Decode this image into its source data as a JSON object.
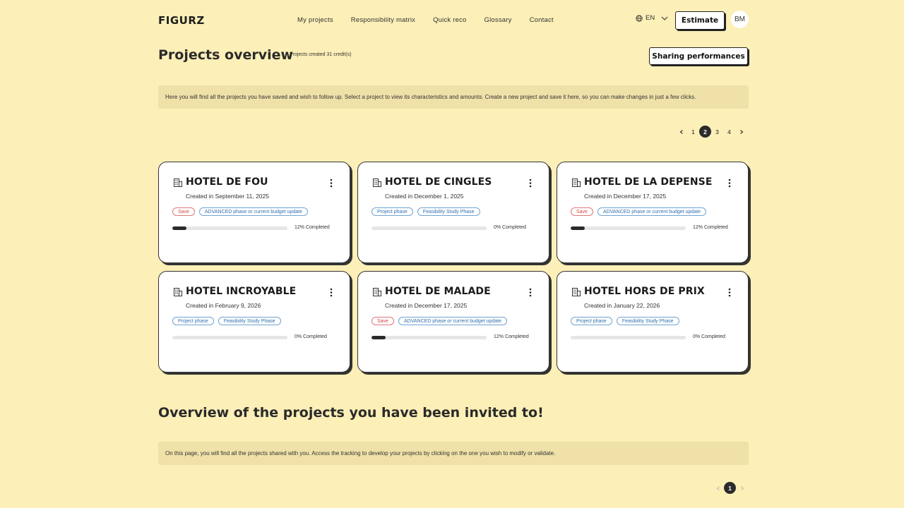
{
  "brand": {
    "logo": "FIGURZ"
  },
  "nav": {
    "items": [
      {
        "label": "My projects"
      },
      {
        "label": "Responsibility matrix"
      },
      {
        "label": "Quick reco"
      },
      {
        "label": "Glossary"
      },
      {
        "label": "Contact"
      }
    ],
    "language": "EN",
    "estimate_label": "Estimate",
    "avatar_initials": "BM"
  },
  "overview": {
    "title": "Projects overview",
    "credits": "Projects created 31 credit(s)",
    "sharing_label": "Sharing performances",
    "info": "Here you will find all the projects you have saved and wish to follow up. Select a project to view its characteristics and amounts. Create a new project and save it here, so you can make changes in just a few clicks.",
    "pagination": {
      "pages": [
        "1",
        "2",
        "3",
        "4"
      ],
      "current": "2"
    }
  },
  "projects": [
    {
      "name": "HOTEL DE FOU",
      "created": "Created in September 11, 2025",
      "tags": [
        {
          "label": "Save",
          "color": "red"
        },
        {
          "label": "ADVANCED phase or current budget update",
          "color": "blue"
        }
      ],
      "progress": 0.12,
      "progress_label": "12% Completed"
    },
    {
      "name": "HOTEL DE CINGLES",
      "created": "Created in December 1, 2025",
      "tags": [
        {
          "label": "Project phase",
          "color": "blue"
        },
        {
          "label": "Feasibility Study Phase",
          "color": "blue"
        }
      ],
      "progress": 0,
      "progress_label": "0% Completed"
    },
    {
      "name": "HOTEL DE LA DEPENSE",
      "created": "Created in December 17, 2025",
      "tags": [
        {
          "label": "Save",
          "color": "red"
        },
        {
          "label": "ADVANCED phase or current budget update",
          "color": "blue"
        }
      ],
      "progress": 0.12,
      "progress_label": "12% Completed"
    },
    {
      "name": "HOTEL INCROYABLE",
      "created": "Created in February 9, 2026",
      "tags": [
        {
          "label": "Project phase",
          "color": "blue"
        },
        {
          "label": "Feasibility Study Phase",
          "color": "blue"
        }
      ],
      "progress": 0,
      "progress_label": "0% Completed"
    },
    {
      "name": "HOTEL DE MALADE",
      "created": "Created in December 17, 2025",
      "tags": [
        {
          "label": "Save",
          "color": "red"
        },
        {
          "label": "ADVANCED phase or current budget update",
          "color": "blue"
        }
      ],
      "progress": 0.12,
      "progress_label": "12% Completed"
    },
    {
      "name": "HOTEL HORS DE PRIX",
      "created": "Created in January 22, 2026",
      "tags": [
        {
          "label": "Project phase",
          "color": "blue"
        },
        {
          "label": "Feasibility Study Phase",
          "color": "blue"
        }
      ],
      "progress": 0,
      "progress_label": "0% Completed"
    }
  ],
  "invited": {
    "title": "Overview of the projects you have been invited to!",
    "info": "On this page, you will find all the projects shared with you. Access the tracking to develop your projects by clicking on the one you wish to modify or validate.",
    "pagination": {
      "pages": [
        "1"
      ],
      "current": "1"
    }
  },
  "colors": {
    "background": "#fcefb7",
    "info_band": "#efe1a8",
    "save_tag": "#d64545",
    "phase_tag": "#2f6fb0",
    "progress_fill": "#2b2b2b"
  },
  "icons": [
    "globe-icon",
    "chevron-down-icon",
    "building-icon",
    "more-vertical-icon",
    "chevron-left-icon",
    "chevron-right-icon"
  ]
}
